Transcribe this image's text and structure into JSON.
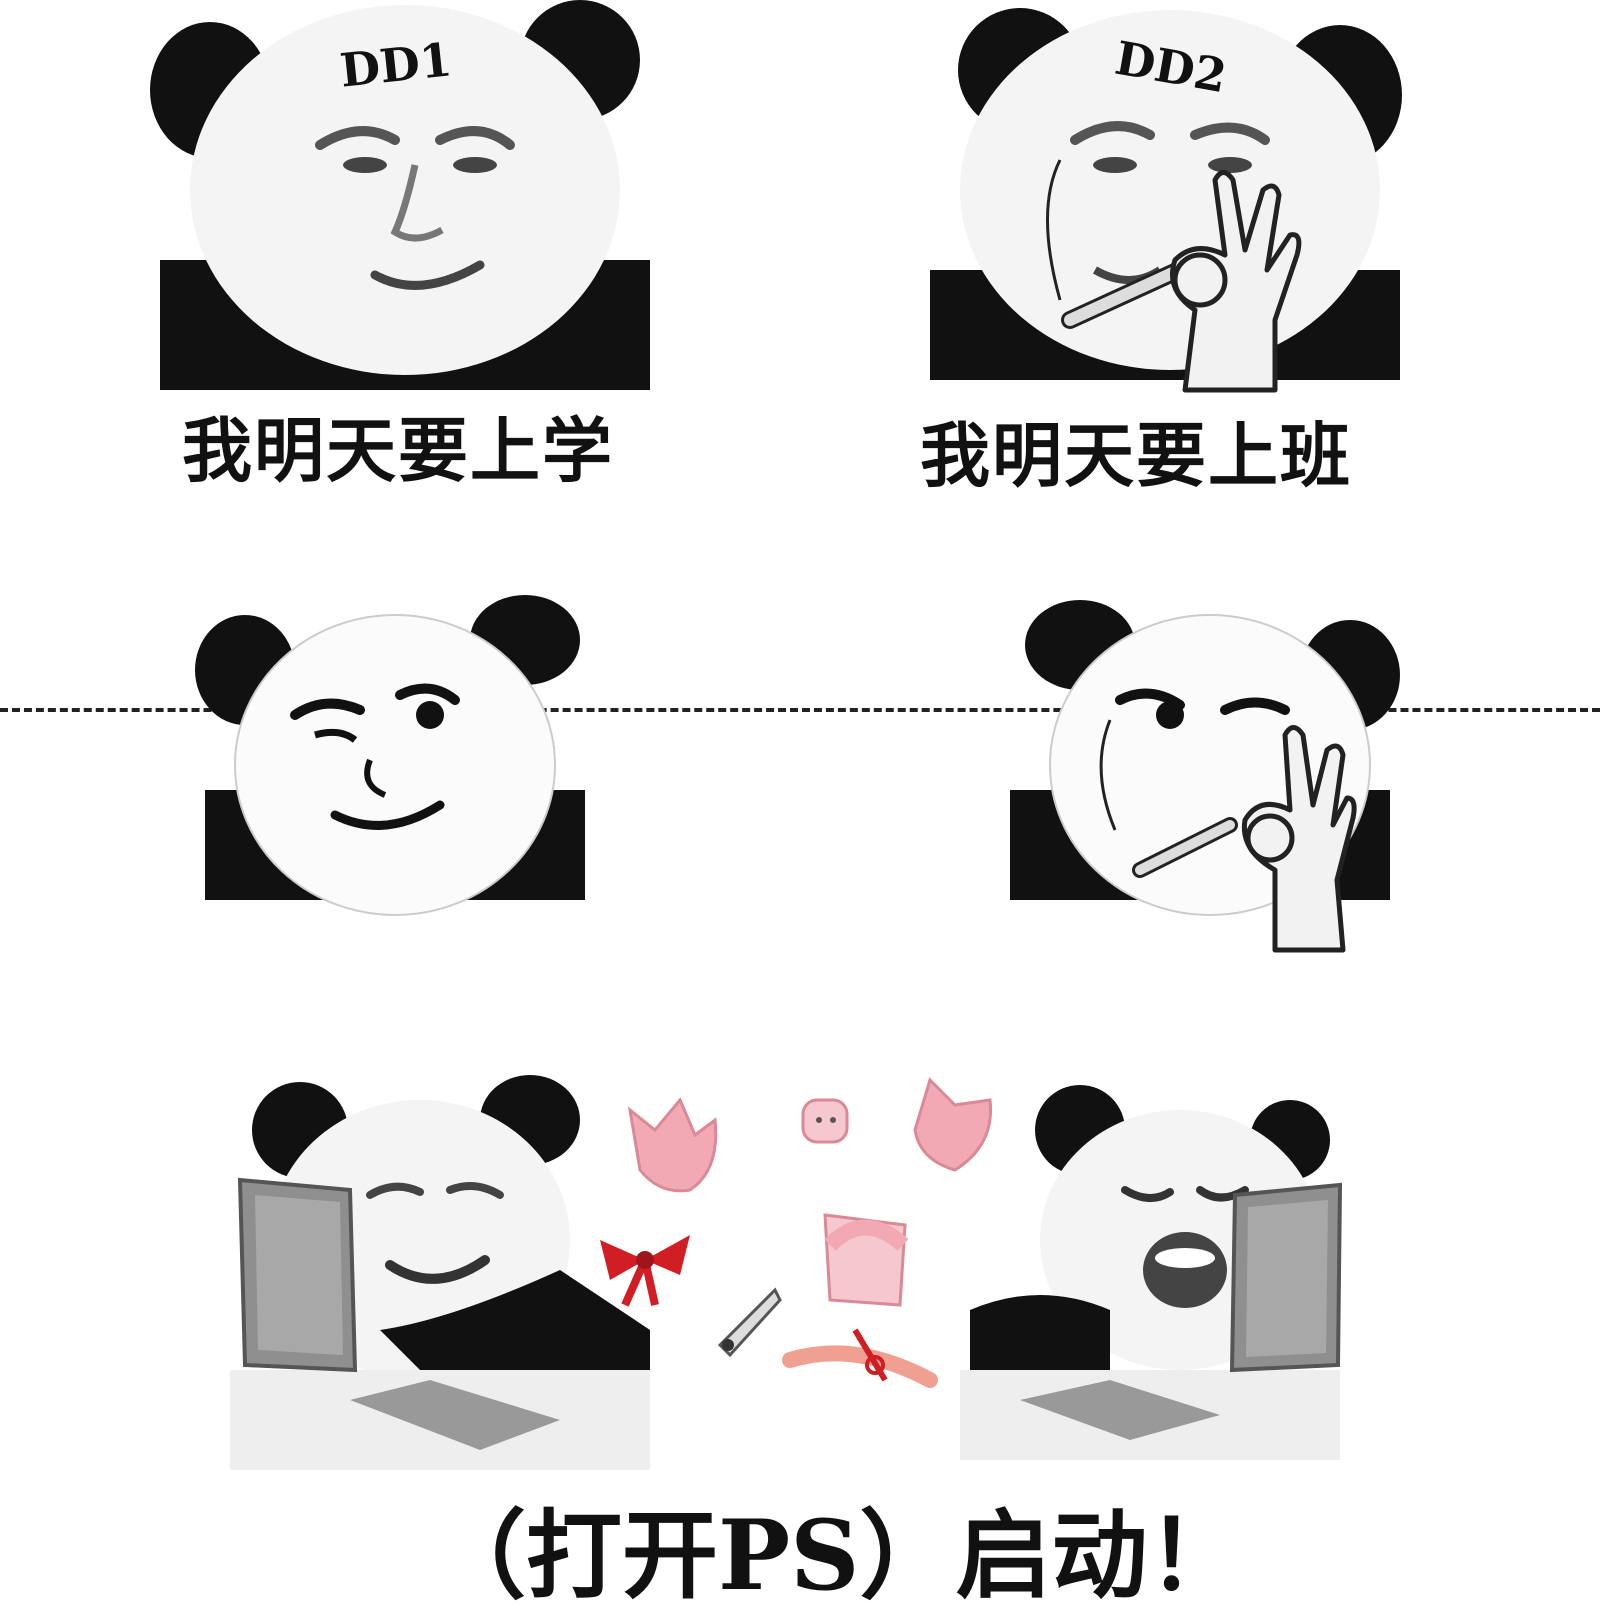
{
  "row1": {
    "left": {
      "tag": "DD1",
      "caption": "我明天要上学"
    },
    "right": {
      "tag": "DD2",
      "caption": "我明天要上班"
    }
  },
  "row3": {
    "caption": "（打开PS）启动！"
  },
  "colors": {
    "panda_black": "#111111",
    "panda_face": "#f2f2f2",
    "pink": "#f2a9b4",
    "red": "#d01e24",
    "gray": "#8f8f8f"
  },
  "icons": [
    "panda-head-icon",
    "ok-hand-icon",
    "cigarette-icon",
    "anime-girl-part-icon",
    "red-bow-icon",
    "laptop-icon"
  ]
}
